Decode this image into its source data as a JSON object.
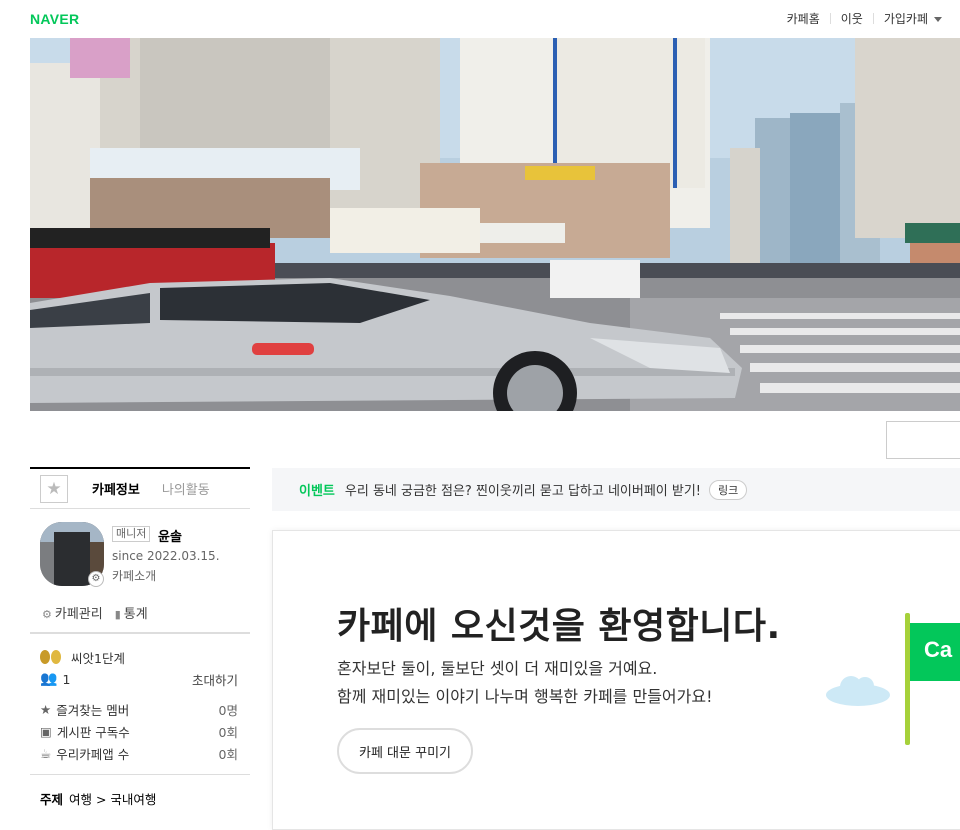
{
  "topbar": {
    "logo": "NAVER",
    "links": [
      "카페홈",
      "이웃",
      "가입카페"
    ]
  },
  "sidebar": {
    "tabs": [
      "카페정보",
      "나의활동"
    ],
    "manager": {
      "role": "매니저",
      "name": "윤솔",
      "since": "since 2022.03.15.",
      "intro": "카페소개"
    },
    "manage_links": [
      "카페관리",
      "통계"
    ],
    "level": "씨앗1단계",
    "member_count": "1",
    "invite": "초대하기",
    "stats": [
      {
        "label": "즐겨찾는 멤버",
        "value": "0명"
      },
      {
        "label": "게시판 구독수",
        "value": "0회"
      },
      {
        "label": "우리카페앱 수",
        "value": "0회"
      }
    ],
    "subject_label": "주제",
    "subject_value": "여행 > 국내여행"
  },
  "event": {
    "tag": "이벤트",
    "text": "우리 동네 궁금한 점은? 찐이웃끼리 묻고 답하고 네이버페이 받기!",
    "chip": "링크"
  },
  "welcome": {
    "title": "카페에 오신것을 환영합니다.",
    "line1": "혼자보단 둘이, 둘보단 셋이 더 재미있을 거예요.",
    "line2": "함께 재미있는 이야기 나누며 행복한 카페를 만들어가요!",
    "button": "카페 대문 꾸미기",
    "flag_text": "Ca"
  },
  "colors": {
    "naver_green": "#03c75a",
    "flag_pole": "#a6d13a"
  }
}
